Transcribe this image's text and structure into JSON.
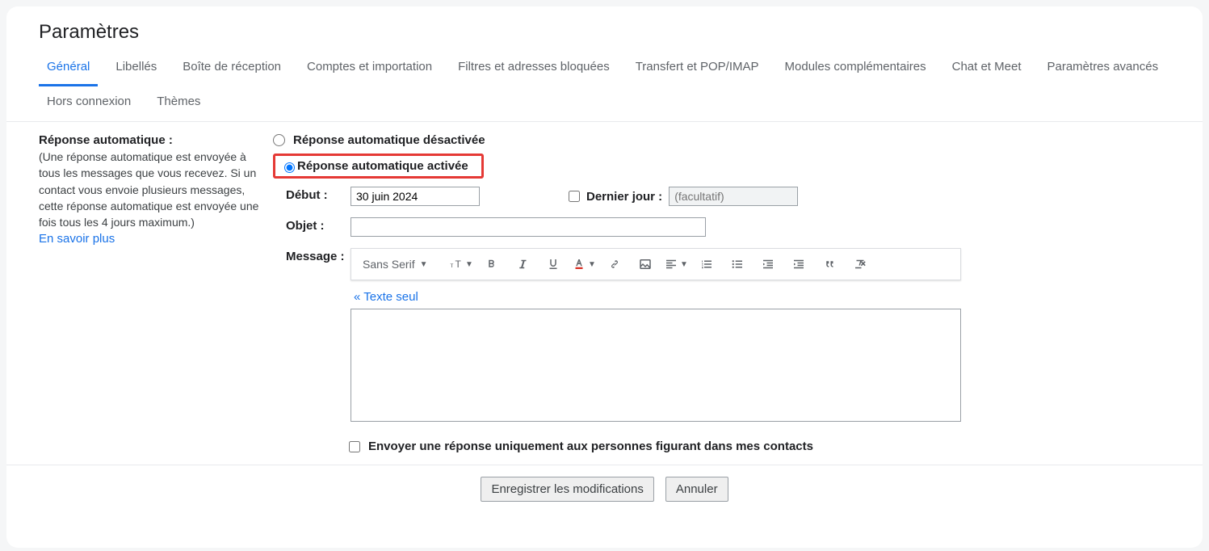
{
  "pageTitle": "Paramètres",
  "tabs": [
    "Général",
    "Libellés",
    "Boîte de réception",
    "Comptes et importation",
    "Filtres et adresses bloquées",
    "Transfert et POP/IMAP",
    "Modules complémentaires",
    "Chat et Meet",
    "Paramètres avancés",
    "Hors connexion",
    "Thèmes"
  ],
  "activeTab": 0,
  "section": {
    "title": "Réponse automatique :",
    "desc": "(Une réponse automatique est envoyée à tous les messages que vous recevez. Si un contact vous envoie plusieurs messages, cette réponse automatique est envoyée une fois tous les 4 jours maximum.)",
    "learnMore": "En savoir plus"
  },
  "radios": {
    "off": "Réponse automatique désactivée",
    "on": "Réponse automatique activée",
    "selected": "on"
  },
  "fields": {
    "startLabel": "Début :",
    "startValue": "30 juin 2024",
    "lastDayLabel": "Dernier jour :",
    "lastDayPlaceholder": "(facultatif)",
    "subjectLabel": "Objet :",
    "subjectValue": "",
    "messageLabel": "Message :"
  },
  "toolbar": {
    "fontName": "Sans Serif"
  },
  "textOnly": "« Texte seul",
  "contactsOnly": "Envoyer une réponse uniquement aux personnes figurant dans mes contacts",
  "buttons": {
    "save": "Enregistrer les modifications",
    "cancel": "Annuler"
  }
}
